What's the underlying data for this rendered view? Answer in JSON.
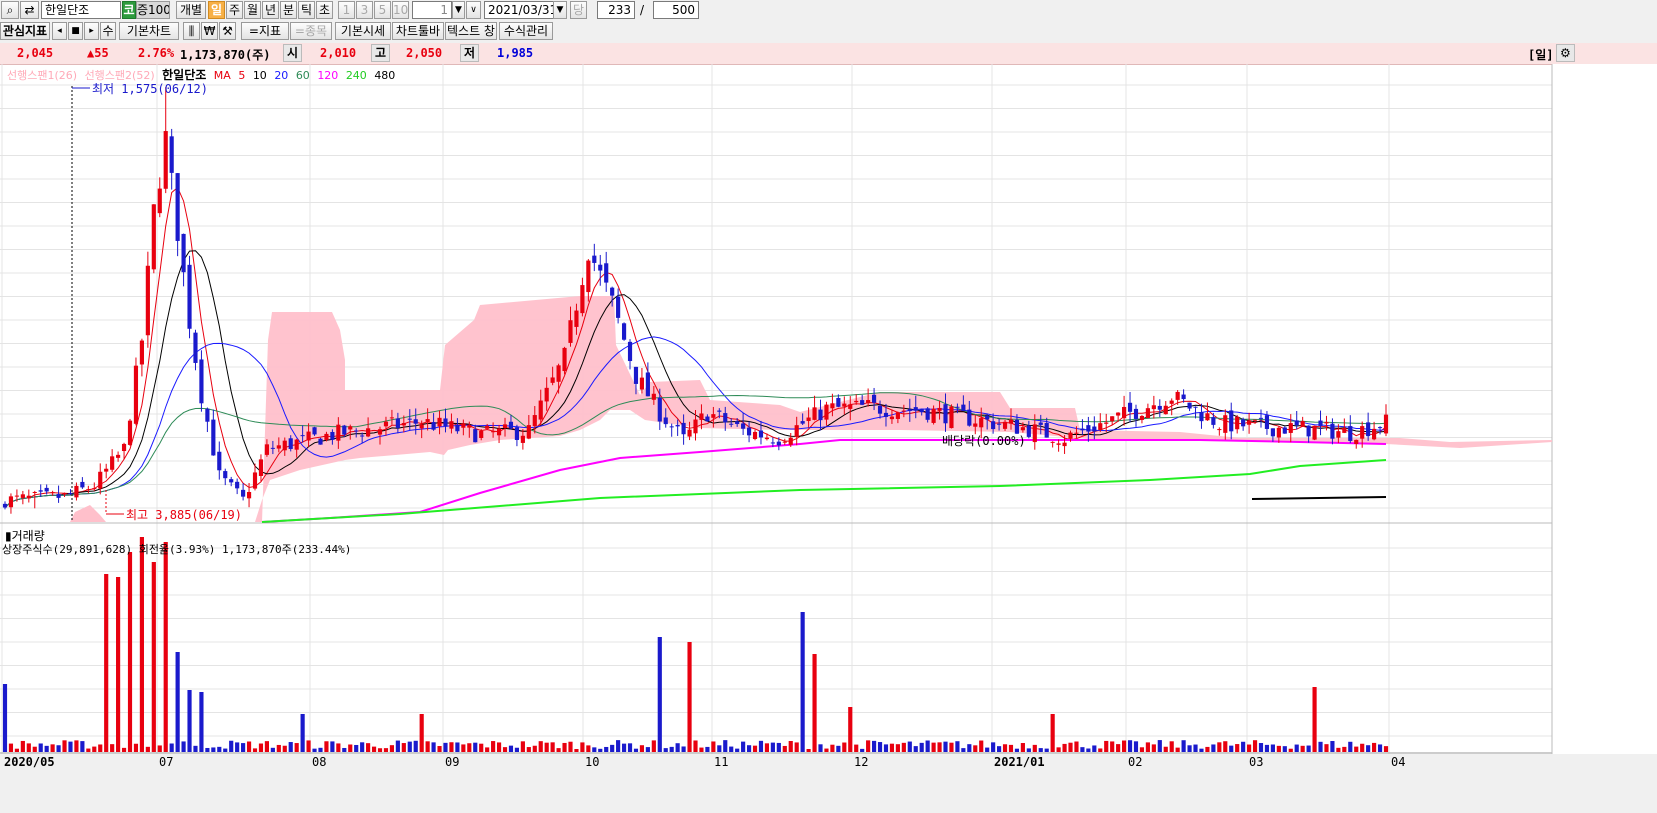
{
  "toolbar1": {
    "stock_name": "한일단조",
    "market_badge": "코",
    "margin_badge": "증100",
    "mode_label": "개별",
    "periods": [
      "일",
      "주",
      "월",
      "년",
      "분",
      "틱",
      "초"
    ],
    "active_period": "일",
    "intervals": [
      "1",
      "3",
      "5",
      "10"
    ],
    "interval_value": "1",
    "date": "2021/03/31",
    "date_suffix": "당",
    "count_value": "233",
    "count_sep": "/",
    "count_total": "500"
  },
  "toolbar2": {
    "watch_label": "관심지표",
    "su_label": "수",
    "basic_chart": "기본차트",
    "indicator": "=지표",
    "compare": "=종목",
    "basic_quote": "기본시세",
    "chart_toolbar": "차트툴바",
    "text_label": "텍스트 창",
    "formula": "수식관리"
  },
  "quote": {
    "price": "2,045",
    "change": "▲55",
    "rate": "2.76%",
    "volume": "1,173,870(주)",
    "open_label": "시",
    "open": "2,010",
    "high_label": "고",
    "high": "2,050",
    "low_label": "저",
    "low": "1,985",
    "period_right": "[일]"
  },
  "legend": {
    "span1": "선행스팬1(26)",
    "span2": "선행스팬2(52)",
    "name": "한일단조",
    "ma_label": "MA",
    "ma": [
      "5",
      "10",
      "20",
      "60",
      "120",
      "240",
      "480"
    ]
  },
  "annotations": {
    "low": "최저 1,575(06/12)",
    "high": "최고 3,885(06/19)",
    "dividend": "배당락(0.00%)"
  },
  "volume_panel": {
    "title": "거래량",
    "info": "상장주식수(29,891,628) 회전율(3.93%) 1,173,870주(233.44%)"
  },
  "colors": {
    "up": "#e8000f",
    "down": "#1a1acc",
    "ichimoku": "#ffc0cb",
    "ma5": "#e8000f",
    "ma10": "#000000",
    "ma20": "#1a1aff",
    "ma60": "#2e8b57",
    "ma120": "#ff00ff",
    "ma240": "#22ee22",
    "ma480": "#000000"
  },
  "chart_data": {
    "type": "candlestick",
    "x_labels": [
      "2020/05",
      "07",
      "08",
      "09",
      "10",
      "11",
      "12",
      "2021/01",
      "02",
      "03",
      "04"
    ],
    "price_low": 1575,
    "price_high": 3885,
    "last_close": 2045,
    "ma_periods": [
      5,
      10,
      20,
      60,
      120,
      240,
      480
    ]
  }
}
